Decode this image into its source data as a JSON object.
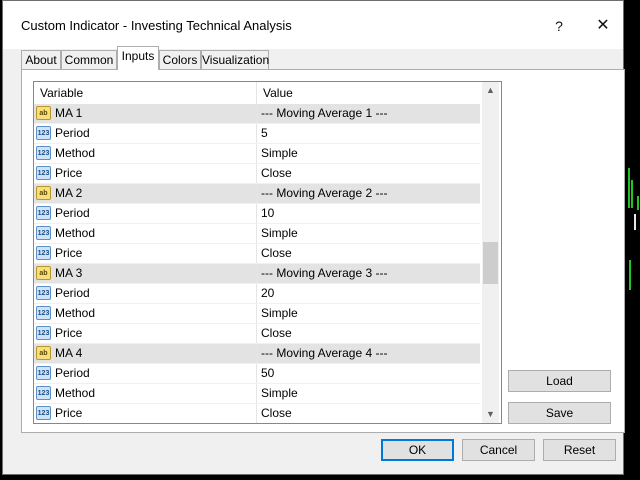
{
  "window": {
    "title": "Custom Indicator - Investing Technical Analysis",
    "help_glyph": "?",
    "close_glyph": "✕"
  },
  "tabs": [
    {
      "label": "About"
    },
    {
      "label": "Common"
    },
    {
      "label": "Inputs",
      "active": true
    },
    {
      "label": "Colors"
    },
    {
      "label": "Visualization"
    }
  ],
  "grid": {
    "headers": {
      "variable": "Variable",
      "value": "Value"
    },
    "rows": [
      {
        "type": "ab",
        "variable": "MA 1",
        "value": "--- Moving Average 1 ---"
      },
      {
        "type": "num",
        "variable": "Period",
        "value": "5"
      },
      {
        "type": "num",
        "variable": "Method",
        "value": "Simple"
      },
      {
        "type": "num",
        "variable": "Price",
        "value": "Close"
      },
      {
        "type": "ab",
        "variable": "MA 2",
        "value": "--- Moving Average 2 ---"
      },
      {
        "type": "num",
        "variable": "Period",
        "value": "10"
      },
      {
        "type": "num",
        "variable": "Method",
        "value": "Simple"
      },
      {
        "type": "num",
        "variable": "Price",
        "value": "Close"
      },
      {
        "type": "ab",
        "variable": "MA 3",
        "value": "--- Moving Average 3 ---"
      },
      {
        "type": "num",
        "variable": "Period",
        "value": "20"
      },
      {
        "type": "num",
        "variable": "Method",
        "value": "Simple"
      },
      {
        "type": "num",
        "variable": "Price",
        "value": "Close"
      },
      {
        "type": "ab",
        "variable": "MA 4",
        "value": "--- Moving Average 4 ---"
      },
      {
        "type": "num",
        "variable": "Period",
        "value": "50"
      },
      {
        "type": "num",
        "variable": "Method",
        "value": "Simple"
      },
      {
        "type": "num",
        "variable": "Price",
        "value": "Close"
      }
    ]
  },
  "side_buttons": {
    "load": "Load",
    "save": "Save"
  },
  "footer_buttons": {
    "ok": "OK",
    "cancel": "Cancel",
    "reset": "Reset"
  },
  "icons": {
    "ab": "ab",
    "num": "123"
  },
  "colors": {
    "accent": "#0078d7",
    "chart_bg": "#000000",
    "candle": "#22c322"
  }
}
